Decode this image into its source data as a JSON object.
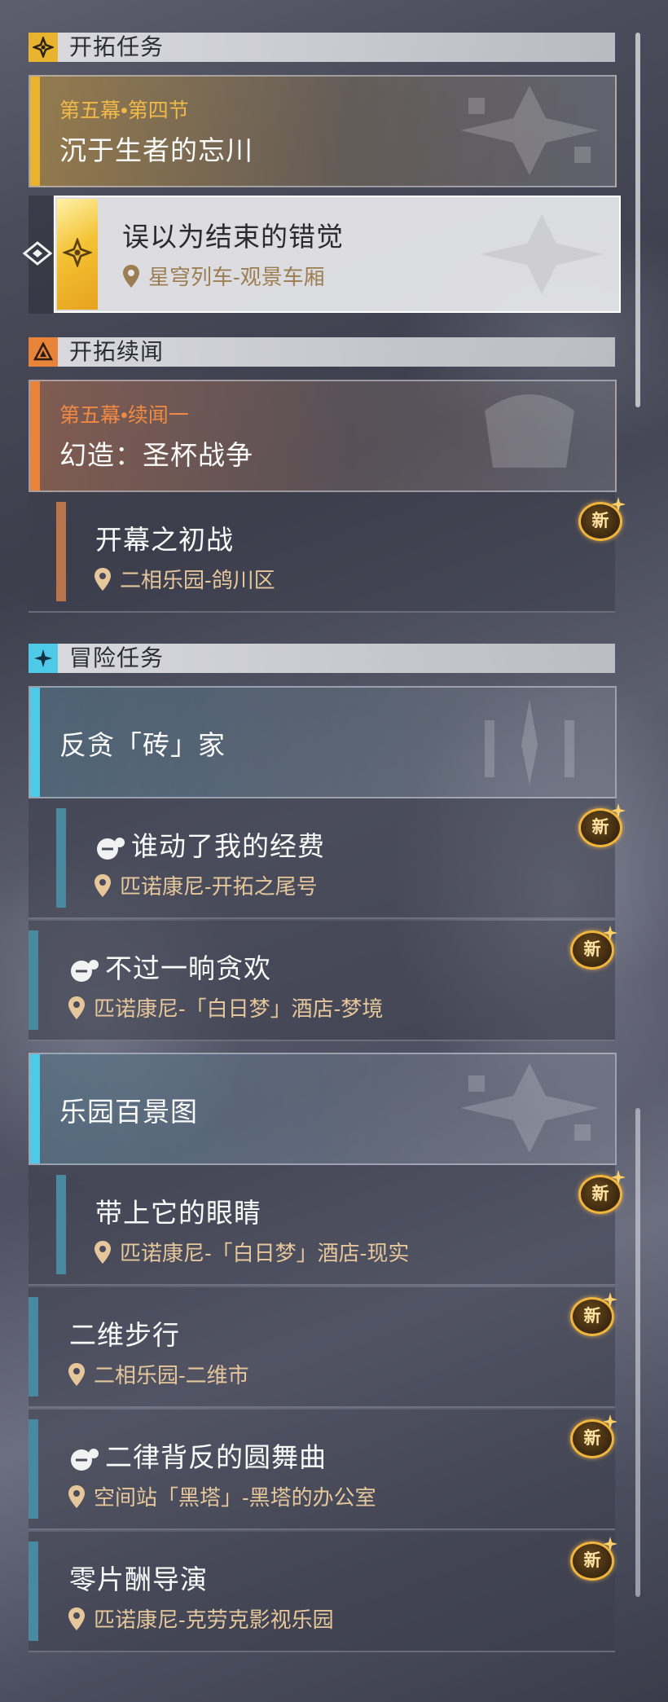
{
  "sections": {
    "trailblaze": {
      "title": "开拓任务",
      "mission": {
        "chapter": "第五幕•第四节",
        "title": "沉于生者的忘川"
      },
      "active_sub": {
        "title": "误以为结束的错觉",
        "location": "星穹列车-观景车厢"
      }
    },
    "continuance": {
      "title": "开拓续闻",
      "mission": {
        "chapter": "第五幕•续闻一",
        "title": "幻造：圣杯战争"
      },
      "sub": {
        "title": "开幕之初战",
        "location": "二相乐园-鸽川区",
        "badge": "新"
      }
    },
    "adventure": {
      "title": "冒险任务",
      "group1": {
        "title": "反贪「砖」家"
      },
      "g1_sub": {
        "title": "谁动了我的经费",
        "location": "匹诺康尼-开拓之尾号",
        "badge": "新"
      },
      "item1": {
        "title": "不过一晌贪欢",
        "location": "匹诺康尼-「白日梦」酒店-梦境",
        "badge": "新"
      },
      "group2": {
        "title": "乐园百景图"
      },
      "g2_sub": {
        "title": "带上它的眼睛",
        "location": "匹诺康尼-「白日梦」酒店-现实",
        "badge": "新"
      },
      "item2": {
        "title": "二维步行",
        "location": "二相乐园-二维市",
        "badge": "新"
      },
      "item3": {
        "title": "二律背反的圆舞曲",
        "location": "空间站「黑塔」-黑塔的办公室",
        "badge": "新"
      },
      "item4": {
        "title": "零片酬导演",
        "location": "匹诺康尼-克劳克影视乐园",
        "badge": "新"
      }
    }
  },
  "colors": {
    "gold": "#e9b22f",
    "orange": "#e8843a",
    "cyan": "#4fc9e8",
    "location": "#e6c79b",
    "badge_ring": "#f0b53c"
  },
  "icons": [
    "trailblaze-icon",
    "continuance-icon",
    "adventure-icon",
    "location-pin-icon",
    "mission-type-icon",
    "selector-arrow-icon",
    "new-badge"
  ]
}
